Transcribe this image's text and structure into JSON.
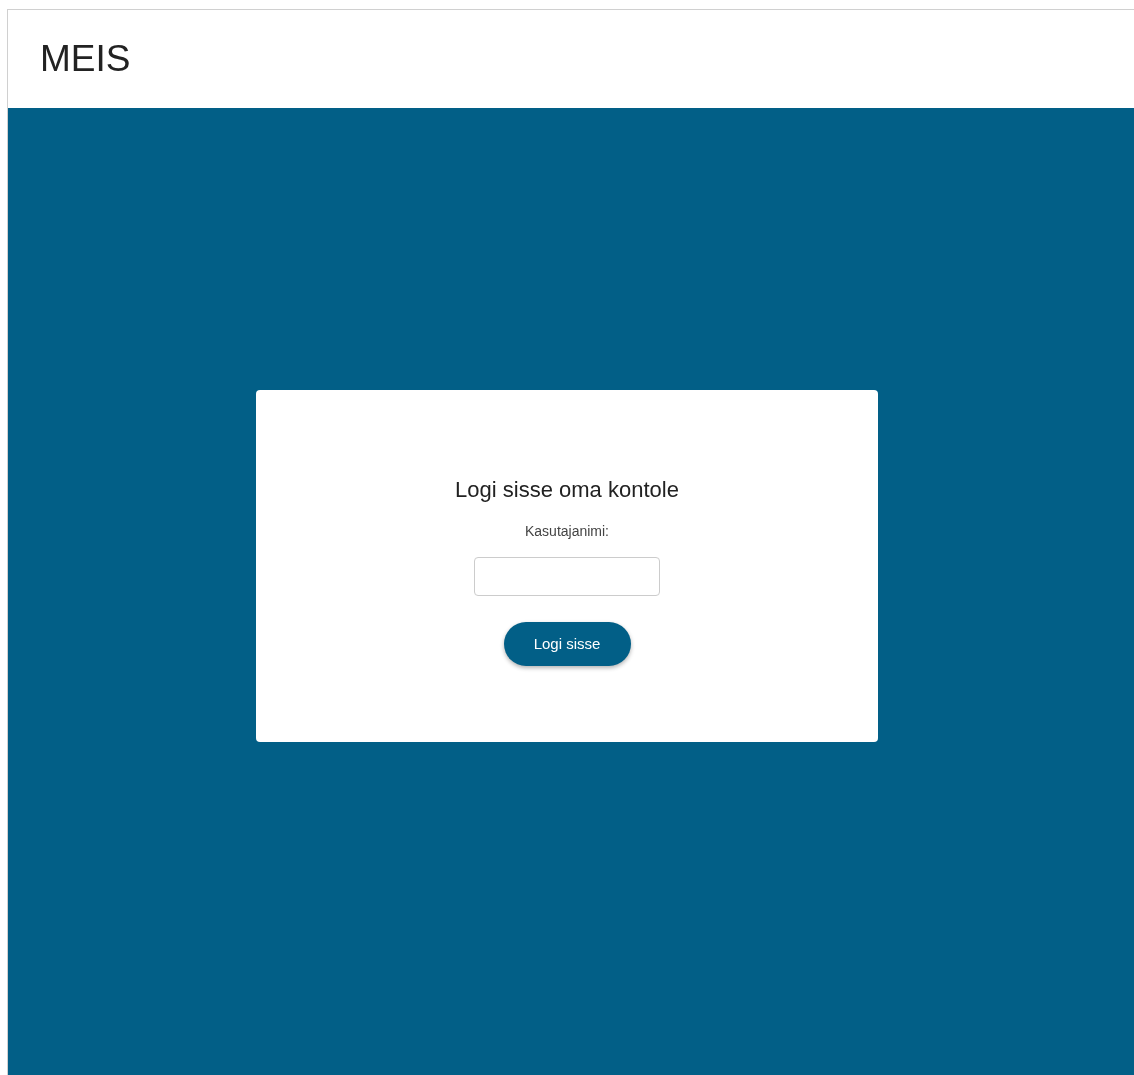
{
  "header": {
    "title": "MEIS"
  },
  "login": {
    "heading": "Logi sisse oma kontole",
    "username_label": "Kasutajanimi:",
    "button": "Logi sisse"
  }
}
